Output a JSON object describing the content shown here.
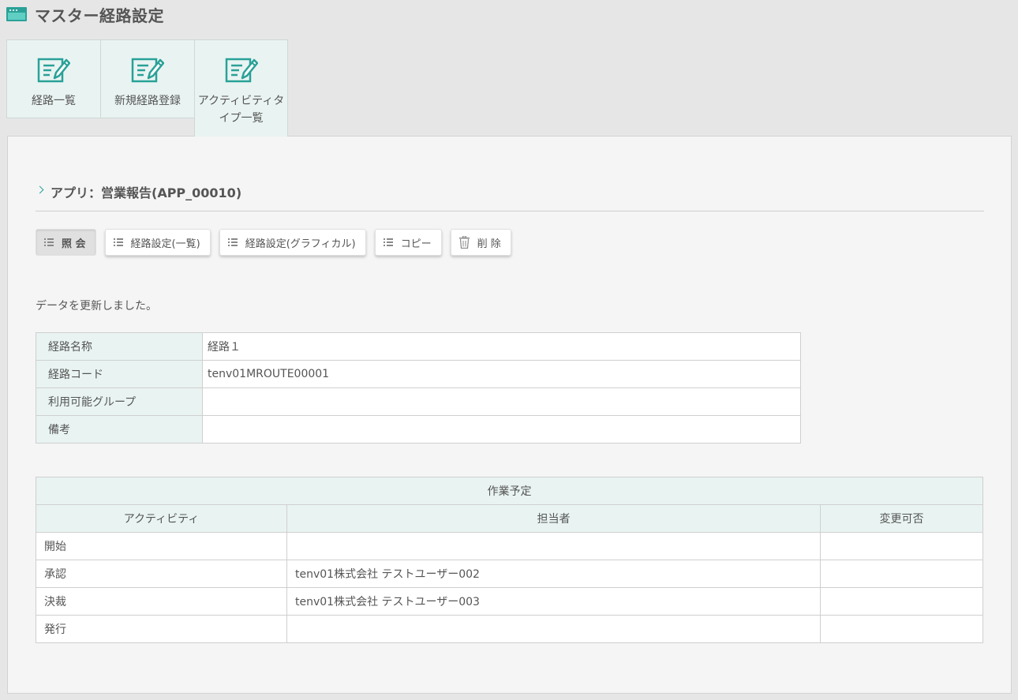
{
  "header": {
    "title": "マスター経路設定",
    "icon": "window-icon"
  },
  "tabs": [
    {
      "label": "経路一覧",
      "icon": "edit-icon"
    },
    {
      "label": "新規経路登録",
      "icon": "edit-icon"
    },
    {
      "label": "アクティビティタイプ一覧",
      "icon": "edit-icon"
    }
  ],
  "section": {
    "title": "アプリ：営業報告(APP_00010)"
  },
  "buttons": {
    "view": "照 会",
    "route_list": "経路設定(一覧)",
    "route_graphical": "経路設定(グラフィカル)",
    "copy": "コピー",
    "delete": "削 除"
  },
  "message": "データを更新しました。",
  "info": {
    "rows": [
      {
        "label": "経路名称",
        "value": "経路１"
      },
      {
        "label": "経路コード",
        "value": "tenv01MROUTE00001"
      },
      {
        "label": "利用可能グループ",
        "value": ""
      },
      {
        "label": "備考",
        "value": ""
      }
    ]
  },
  "schedule": {
    "caption": "作業予定",
    "headers": [
      "アクティビティ",
      "担当者",
      "変更可否"
    ],
    "rows": [
      {
        "activity": "開始",
        "assignee": "",
        "changeable": ""
      },
      {
        "activity": "承認",
        "assignee": "tenv01株式会社 テストユーザー002",
        "changeable": ""
      },
      {
        "activity": "決裁",
        "assignee": "tenv01株式会社 テストユーザー003",
        "changeable": ""
      },
      {
        "activity": "発行",
        "assignee": "",
        "changeable": ""
      }
    ]
  },
  "colors": {
    "accent": "#2aa198",
    "label_bg": "#e9f4f2",
    "page_bg": "#e6e6e6"
  }
}
